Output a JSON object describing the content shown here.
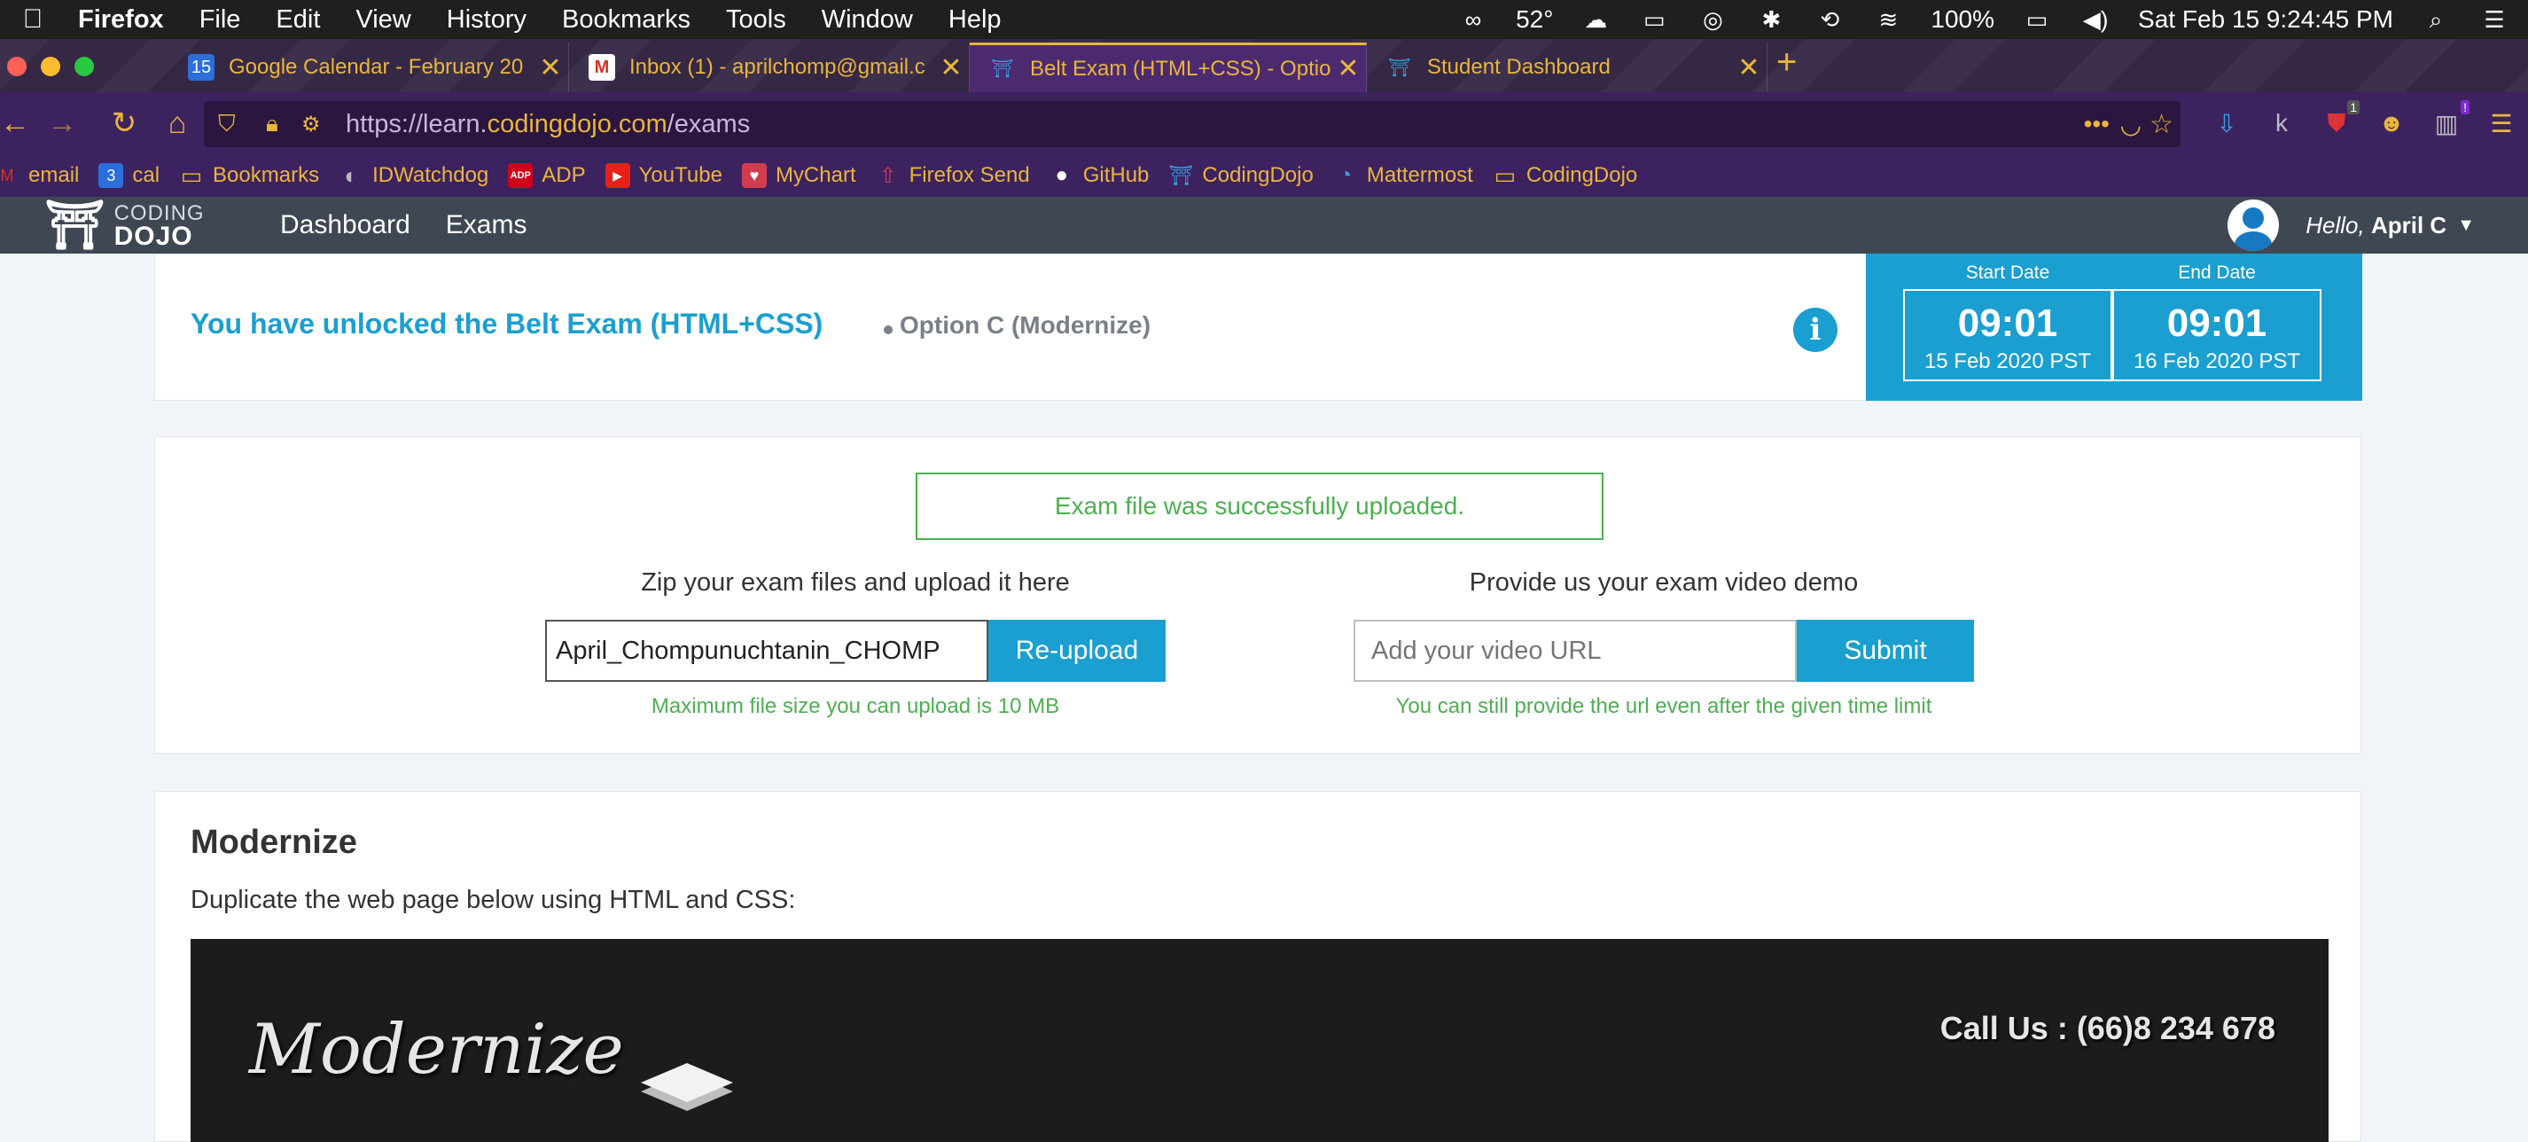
{
  "menubar": {
    "app": "Firefox",
    "items": [
      "File",
      "Edit",
      "View",
      "History",
      "Bookmarks",
      "Tools",
      "Window",
      "Help"
    ],
    "temperature": "52°",
    "battery": "100%",
    "datetime": "Sat Feb 15  9:24:45 PM"
  },
  "tabs": [
    {
      "title": "Google Calendar - February 20",
      "favicon": "calendar-icon",
      "fav_text": "15"
    },
    {
      "title": "Inbox (1) - aprilchomp@gmail.c",
      "favicon": "gmail-icon",
      "fav_text": "M"
    },
    {
      "title": "Belt Exam (HTML+CSS) - Optio",
      "favicon": "coding-dojo-icon",
      "fav_text": "⛩"
    },
    {
      "title": "Student Dashboard",
      "favicon": "coding-dojo-icon",
      "fav_text": "⛩"
    }
  ],
  "navbar": {
    "url_prefix": "https://learn.",
    "url_domain": "codingdojo.com",
    "url_path": "/exams",
    "ext_badge_1": "1",
    "ext_badge_2": "!"
  },
  "bookmarks": [
    {
      "label": "email",
      "icon": "gmail-icon",
      "glyph": "M",
      "color": "#d93025"
    },
    {
      "label": "cal",
      "icon": "calendar-icon",
      "glyph": "3",
      "color": "#2a6fdb"
    },
    {
      "label": "Bookmarks",
      "icon": "folder-icon",
      "glyph": "▭",
      "color": "#e9b63a"
    },
    {
      "label": "IDWatchdog",
      "icon": "idwatchdog-icon",
      "glyph": "◐",
      "color": "#666"
    },
    {
      "label": "ADP",
      "icon": "adp-icon",
      "glyph": "ADP",
      "color": "#d0021b"
    },
    {
      "label": "YouTube",
      "icon": "youtube-icon",
      "glyph": "▶",
      "color": "#e62117"
    },
    {
      "label": "MyChart",
      "icon": "mychart-icon",
      "glyph": "♥",
      "color": "#d33b4f"
    },
    {
      "label": "Firefox Send",
      "icon": "firefox-send-icon",
      "glyph": "⇧",
      "color": "#d33b4f"
    },
    {
      "label": "GitHub",
      "icon": "github-icon",
      "glyph": "●",
      "color": "#333"
    },
    {
      "label": "CodingDojo",
      "icon": "coding-dojo-icon",
      "glyph": "⛩",
      "color": "#2a6fdb"
    },
    {
      "label": "Mattermost",
      "icon": "mattermost-icon",
      "glyph": "◔",
      "color": "#2a6fdb"
    },
    {
      "label": "CodingDojo",
      "icon": "folder-icon",
      "glyph": "▭",
      "color": "#e9b63a"
    }
  ],
  "app": {
    "logo_top": "CODING",
    "logo_bottom": "DOJO",
    "nav": [
      "Dashboard",
      "Exams"
    ],
    "greeting": "Hello,",
    "user_name": "April C"
  },
  "banner": {
    "unlock_text": "You have unlocked the Belt Exam (HTML+CSS)",
    "option_text": "Option C (Modernize)",
    "start_label": "Start Date",
    "start_time": "09:01",
    "start_day": "15 Feb 2020 PST",
    "end_label": "End Date",
    "end_time": "09:01",
    "end_day": "16 Feb 2020 PST"
  },
  "upload": {
    "success_message": "Exam file was successfully uploaded.",
    "zip_title": "Zip your exam files and upload it here",
    "file_value": "April_Chompunuchtanin_CHOMP",
    "reupload_label": "Re-upload",
    "zip_note": "Maximum file size you can upload is 10 MB",
    "video_title": "Provide us your exam video demo",
    "video_placeholder": "Add your video URL",
    "submit_label": "Submit",
    "video_note": "You can still provide the url even after the given time limit"
  },
  "section": {
    "title": "Modernize",
    "description": "Duplicate the web page below using HTML and CSS:",
    "preview_brand": "Modernize",
    "preview_call": "Call Us : (66)8 234 678"
  },
  "colors": {
    "accent": "#1a9fd0",
    "success": "#4caf50",
    "firefox_chrome": "#3d2260",
    "firefox_text": "#e9b63a",
    "app_header": "#3f4752"
  }
}
